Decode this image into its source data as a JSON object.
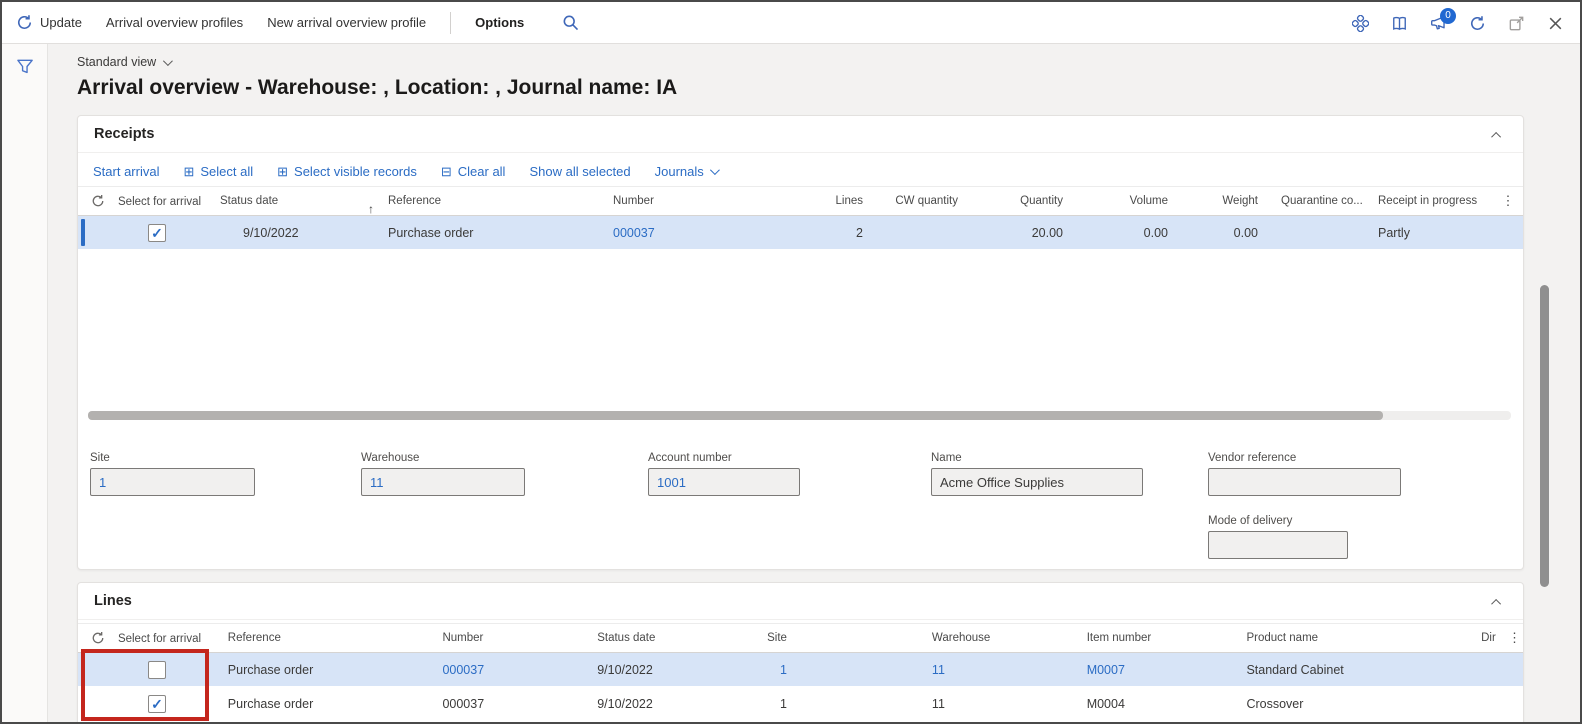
{
  "appbar": {
    "update_label": "Update",
    "profiles_label": "Arrival overview profiles",
    "new_profile_label": "New arrival overview profile",
    "options_label": "Options",
    "notification_badge": "0"
  },
  "page": {
    "view_name": "Standard view",
    "title": "Arrival overview - Warehouse: , Location: , Journal name: IA"
  },
  "receipts": {
    "title": "Receipts",
    "toolbar": {
      "start_arrival": "Start arrival",
      "select_all": "Select all",
      "select_visible": "Select visible records",
      "clear_all": "Clear all",
      "show_all_selected": "Show all selected",
      "journals": "Journals"
    },
    "columns": [
      "Select for arrival",
      "Status date",
      "Reference",
      "Number",
      "Lines",
      "CW quantity",
      "Quantity",
      "Volume",
      "Weight",
      "Quarantine co...",
      "Receipt in progress"
    ],
    "rows": [
      {
        "selected": true,
        "checked": true,
        "status_date": "9/10/2022",
        "reference": "Purchase order",
        "number": "000037",
        "lines": "2",
        "cw_quantity": "",
        "quantity": "20.00",
        "volume": "0.00",
        "weight": "0.00",
        "quarantine": "",
        "receipt_in_progress": "Partly"
      }
    ],
    "fields": {
      "site_label": "Site",
      "site_value": "1",
      "warehouse_label": "Warehouse",
      "warehouse_value": "11",
      "account_label": "Account number",
      "account_value": "1001",
      "name_label": "Name",
      "name_value": "Acme Office Supplies",
      "vendor_ref_label": "Vendor reference",
      "vendor_ref_value": "",
      "mode_label": "Mode of delivery",
      "mode_value": ""
    }
  },
  "lines": {
    "title": "Lines",
    "columns": [
      "Select for arrival",
      "Reference",
      "Number",
      "Status date",
      "Site",
      "Warehouse",
      "Item number",
      "Product name",
      "Dir"
    ],
    "rows": [
      {
        "selected": true,
        "checked": false,
        "reference": "Purchase order",
        "number": "000037",
        "status_date": "9/10/2022",
        "site": "1",
        "warehouse": "11",
        "item_number": "M0007",
        "product_name": "Standard Cabinet"
      },
      {
        "selected": false,
        "checked": true,
        "reference": "Purchase order",
        "number": "000037",
        "status_date": "9/10/2022",
        "site": "1",
        "warehouse": "11",
        "item_number": "M0004",
        "product_name": "Crossover"
      }
    ]
  },
  "glyphs": {
    "sort_asc": "↑",
    "kebab": "⋮",
    "check": "✓",
    "grid_select": "⊞",
    "clear": "⊟"
  },
  "colors": {
    "accent": "#2b6cc4",
    "selected-row": "#d7e4f7",
    "annotation-red": "#c4261d",
    "badge-blue": "#2168d1"
  }
}
